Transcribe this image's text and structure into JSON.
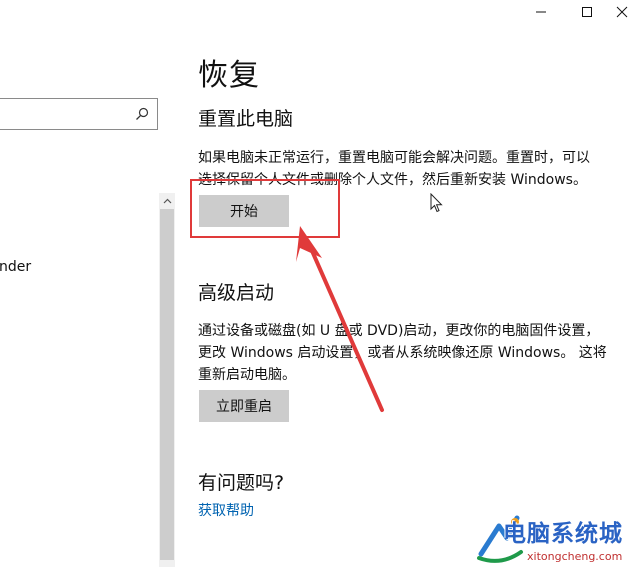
{
  "window": {
    "minimize_icon": "minimize-icon",
    "maximize_icon": "maximize-icon",
    "close_icon": "close-icon"
  },
  "sidebar": {
    "search_placeholder": "",
    "partial_item": "nder"
  },
  "main": {
    "page_title": "恢复",
    "reset": {
      "title": "重置此电脑",
      "desc_line1": "如果电脑未正常运行，重置电脑可能会解决问题。重置时，可以",
      "desc_line2": "选择保留个人文件或删除个人文件，然后重新安装 Windows。",
      "button": "开始"
    },
    "advanced": {
      "title": "高级启动",
      "desc_line1": "通过设备或磁盘(如 U 盘或 DVD)启动，更改你的电脑固件设置，",
      "desc_line2": "更改 Windows 启动设置，或者从系统映像还原 Windows。 这将",
      "desc_line3": "重新启动电脑。",
      "button": "立即重启"
    },
    "help": {
      "title": "有问题吗?",
      "link": "获取帮助"
    }
  },
  "watermark": {
    "text": "电脑系统城",
    "url": "xitongcheng.com"
  },
  "colors": {
    "annotation": "#e03a3a",
    "link": "#0063b1",
    "button": "#cccccc"
  }
}
